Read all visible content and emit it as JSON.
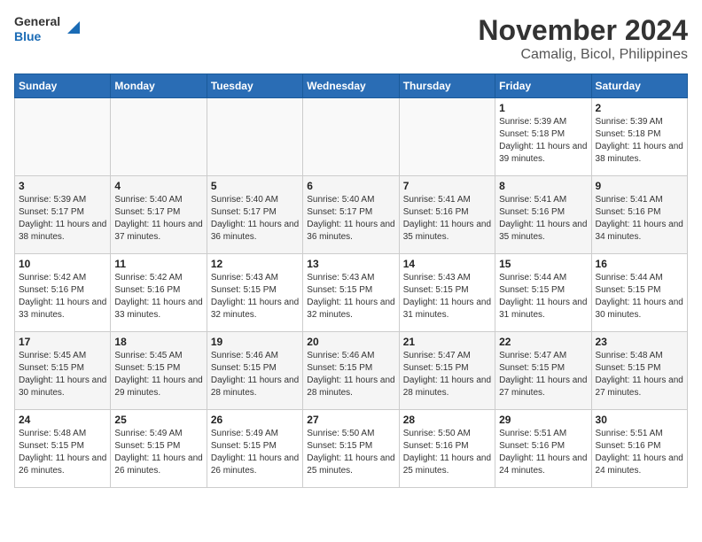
{
  "header": {
    "logo": {
      "line1": "General",
      "line2": "Blue"
    },
    "title": "November 2024",
    "subtitle": "Camalig, Bicol, Philippines"
  },
  "weekdays": [
    "Sunday",
    "Monday",
    "Tuesday",
    "Wednesday",
    "Thursday",
    "Friday",
    "Saturday"
  ],
  "weeks": [
    [
      {
        "day": "",
        "empty": true
      },
      {
        "day": "",
        "empty": true
      },
      {
        "day": "",
        "empty": true
      },
      {
        "day": "",
        "empty": true
      },
      {
        "day": "",
        "empty": true
      },
      {
        "day": "1",
        "sunrise": "5:39 AM",
        "sunset": "5:18 PM",
        "daylight": "11 hours and 39 minutes."
      },
      {
        "day": "2",
        "sunrise": "5:39 AM",
        "sunset": "5:18 PM",
        "daylight": "11 hours and 38 minutes."
      }
    ],
    [
      {
        "day": "3",
        "sunrise": "5:39 AM",
        "sunset": "5:17 PM",
        "daylight": "11 hours and 38 minutes."
      },
      {
        "day": "4",
        "sunrise": "5:40 AM",
        "sunset": "5:17 PM",
        "daylight": "11 hours and 37 minutes."
      },
      {
        "day": "5",
        "sunrise": "5:40 AM",
        "sunset": "5:17 PM",
        "daylight": "11 hours and 36 minutes."
      },
      {
        "day": "6",
        "sunrise": "5:40 AM",
        "sunset": "5:17 PM",
        "daylight": "11 hours and 36 minutes."
      },
      {
        "day": "7",
        "sunrise": "5:41 AM",
        "sunset": "5:16 PM",
        "daylight": "11 hours and 35 minutes."
      },
      {
        "day": "8",
        "sunrise": "5:41 AM",
        "sunset": "5:16 PM",
        "daylight": "11 hours and 35 minutes."
      },
      {
        "day": "9",
        "sunrise": "5:41 AM",
        "sunset": "5:16 PM",
        "daylight": "11 hours and 34 minutes."
      }
    ],
    [
      {
        "day": "10",
        "sunrise": "5:42 AM",
        "sunset": "5:16 PM",
        "daylight": "11 hours and 33 minutes."
      },
      {
        "day": "11",
        "sunrise": "5:42 AM",
        "sunset": "5:16 PM",
        "daylight": "11 hours and 33 minutes."
      },
      {
        "day": "12",
        "sunrise": "5:43 AM",
        "sunset": "5:15 PM",
        "daylight": "11 hours and 32 minutes."
      },
      {
        "day": "13",
        "sunrise": "5:43 AM",
        "sunset": "5:15 PM",
        "daylight": "11 hours and 32 minutes."
      },
      {
        "day": "14",
        "sunrise": "5:43 AM",
        "sunset": "5:15 PM",
        "daylight": "11 hours and 31 minutes."
      },
      {
        "day": "15",
        "sunrise": "5:44 AM",
        "sunset": "5:15 PM",
        "daylight": "11 hours and 31 minutes."
      },
      {
        "day": "16",
        "sunrise": "5:44 AM",
        "sunset": "5:15 PM",
        "daylight": "11 hours and 30 minutes."
      }
    ],
    [
      {
        "day": "17",
        "sunrise": "5:45 AM",
        "sunset": "5:15 PM",
        "daylight": "11 hours and 30 minutes."
      },
      {
        "day": "18",
        "sunrise": "5:45 AM",
        "sunset": "5:15 PM",
        "daylight": "11 hours and 29 minutes."
      },
      {
        "day": "19",
        "sunrise": "5:46 AM",
        "sunset": "5:15 PM",
        "daylight": "11 hours and 28 minutes."
      },
      {
        "day": "20",
        "sunrise": "5:46 AM",
        "sunset": "5:15 PM",
        "daylight": "11 hours and 28 minutes."
      },
      {
        "day": "21",
        "sunrise": "5:47 AM",
        "sunset": "5:15 PM",
        "daylight": "11 hours and 28 minutes."
      },
      {
        "day": "22",
        "sunrise": "5:47 AM",
        "sunset": "5:15 PM",
        "daylight": "11 hours and 27 minutes."
      },
      {
        "day": "23",
        "sunrise": "5:48 AM",
        "sunset": "5:15 PM",
        "daylight": "11 hours and 27 minutes."
      }
    ],
    [
      {
        "day": "24",
        "sunrise": "5:48 AM",
        "sunset": "5:15 PM",
        "daylight": "11 hours and 26 minutes."
      },
      {
        "day": "25",
        "sunrise": "5:49 AM",
        "sunset": "5:15 PM",
        "daylight": "11 hours and 26 minutes."
      },
      {
        "day": "26",
        "sunrise": "5:49 AM",
        "sunset": "5:15 PM",
        "daylight": "11 hours and 26 minutes."
      },
      {
        "day": "27",
        "sunrise": "5:50 AM",
        "sunset": "5:15 PM",
        "daylight": "11 hours and 25 minutes."
      },
      {
        "day": "28",
        "sunrise": "5:50 AM",
        "sunset": "5:16 PM",
        "daylight": "11 hours and 25 minutes."
      },
      {
        "day": "29",
        "sunrise": "5:51 AM",
        "sunset": "5:16 PM",
        "daylight": "11 hours and 24 minutes."
      },
      {
        "day": "30",
        "sunrise": "5:51 AM",
        "sunset": "5:16 PM",
        "daylight": "11 hours and 24 minutes."
      }
    ]
  ],
  "labels": {
    "sunrise": "Sunrise:",
    "sunset": "Sunset:",
    "daylight": "Daylight:"
  }
}
